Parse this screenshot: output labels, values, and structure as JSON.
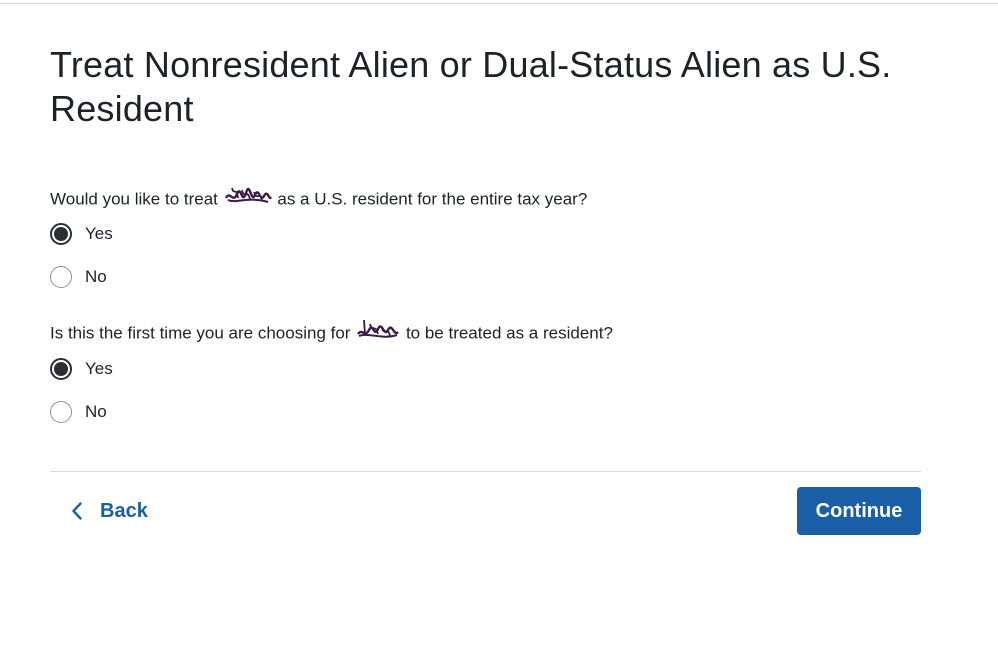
{
  "page": {
    "title": "Treat Nonresident Alien or Dual-Status Alien as U.S. Resident"
  },
  "questions": [
    {
      "text_before": "Would you like to treat",
      "text_after": "as a U.S. resident for the entire tax year?",
      "options": [
        {
          "label": "Yes",
          "selected": true
        },
        {
          "label": "No",
          "selected": false
        }
      ]
    },
    {
      "text_before": "Is this the first time you are choosing for",
      "text_after": "to be treated as a resident?",
      "options": [
        {
          "label": "Yes",
          "selected": true
        },
        {
          "label": "No",
          "selected": false
        }
      ]
    }
  ],
  "navigation": {
    "back_label": "Back",
    "continue_label": "Continue"
  },
  "colors": {
    "accent": "#1a5ea8",
    "text": "#1e2227",
    "radio_selected": "#2b2f33",
    "redaction_scribble": "#3b1a4a"
  },
  "icons": {
    "back": "chevron-left-icon"
  }
}
